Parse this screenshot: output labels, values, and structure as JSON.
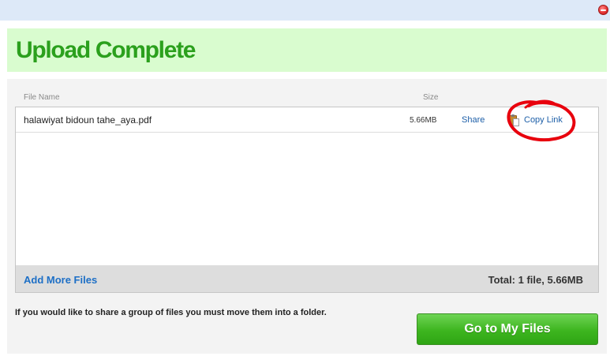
{
  "window": {
    "close_icon": "close-icon"
  },
  "header": {
    "title": "Upload Complete"
  },
  "table": {
    "columns": [
      "File Name",
      "Size"
    ],
    "rows": [
      {
        "file_name": "halawiyat bidoun tahe_aya.pdf",
        "size": "5.66MB",
        "share_label": "Share",
        "copy_link_label": "Copy Link",
        "copy_icon": "clipboard-icon"
      }
    ]
  },
  "footer": {
    "add_more_label": "Add More Files",
    "total": "Total: 1 file, 5.66MB"
  },
  "note": "If you would like to share a group of files you must move them into a folder.",
  "go_to_files_label": "Go to My Files",
  "colors": {
    "title_green": "#2ba01d",
    "header_bg": "#d9fccf",
    "link_blue": "#1d5fa8",
    "button_green": "#3db51f",
    "annotation_red": "#e8000d"
  }
}
